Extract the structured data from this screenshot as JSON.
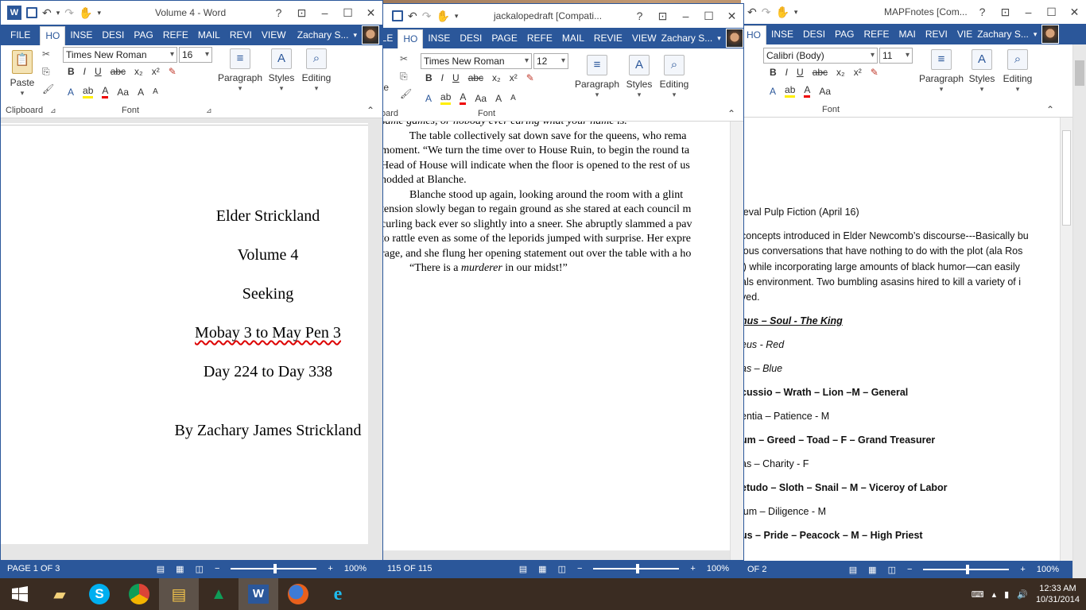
{
  "windows": {
    "left": {
      "title": "Volume 4 - Word",
      "tabs": [
        "FILE",
        "HO",
        "INSE",
        "DESI",
        "PAG",
        "REFE",
        "MAIL",
        "REVI",
        "VIEW"
      ],
      "user": "Zachary S...",
      "font_name": "Times New Roman",
      "font_size": "16",
      "groups": {
        "clipboard": "Clipboard",
        "font": "Font"
      },
      "paste_label": "Paste",
      "paragraph_label": "Paragraph",
      "styles_label": "Styles",
      "editing_label": "Editing",
      "doc_lines": [
        "Elder Strickland",
        "Volume 4",
        "Seeking",
        "Mobay 3 to May Pen 3",
        "Day 224 to Day 338",
        "By Zachary James Strickland"
      ],
      "status_page": "PAGE 1 OF 3",
      "zoom": "100%"
    },
    "middle": {
      "title": "jackalopedraft [Compati...",
      "tabs": [
        "FILE",
        "HO",
        "INSE",
        "DESI",
        "PAGE",
        "REFE",
        "MAIL",
        "REVIE",
        "VIEW"
      ],
      "user": "Zachary S...",
      "font_name": "Times New Roman",
      "font_size": "12",
      "groups": {
        "clipboard": "oard",
        "font": "Font"
      },
      "paste_label": "te",
      "paragraph_label": "Paragraph",
      "styles_label": "Styles",
      "editing_label": "Editing",
      "paragraphs": [
        "same games, or nobody ever caring what your name is.",
        "        The table collectively sat down save for the queens, who rema",
        "moment. “We turn the time over to House Ruin, to begin the round ta",
        "Head of House will indicate when the floor is opened to the rest of us",
        "nodded at Blanche.",
        "        Blanche stood up again, looking around the room with a glint",
        "tension slowly began to regain ground as she stared at each council m",
        "curling back ever so slightly into a sneer. She abruptly slammed a pav",
        "to rattle even as some of the leporids jumped with surprise. Her expre",
        "rage, and she flung her opening statement out over the table with a ho",
        "        “There is a murderer in our midst!”"
      ],
      "status_page": "115 OF 115",
      "zoom": "100%"
    },
    "right": {
      "title": "MAPFnotes [Com...",
      "tabs": [
        "HO",
        "INSE",
        "DESI",
        "PAG",
        "REFE",
        "MAI",
        "REVI",
        "VIE"
      ],
      "user": "Zachary S...",
      "font_name": "Calibri (Body)",
      "font_size": "11",
      "groups": {
        "font": "Font"
      },
      "paragraph_label": "Paragraph",
      "styles_label": "Styles",
      "editing_label": "Editing",
      "lines": [
        "ieval Pulp Fiction (April 16)",
        "concepts introduced in Elder Newcomb’s discourse---Basically bu",
        "ious conversations that have nothing to do with the plot (ala Ros",
        "l) while incorporating large amounts of black humor—can easily",
        "als environment. Two bumbling asasins hired to kill a variety of i",
        "ved.",
        "nus – Soul - The King",
        "eus - Red",
        "as – Blue",
        "cussio – Wrath – Lion –M – General",
        "entia – Patience - M",
        "um – Greed – Toad – F – Grand Treasurer",
        "as – Charity - F",
        "etudo – Sloth – Snail – M – Viceroy of Labor",
        "ium – Diligence - M",
        "us – Pride – Peacock – M – High Priest"
      ],
      "status_page": "OF 2",
      "zoom": "100%"
    }
  },
  "taskbar": {
    "apps": [
      "start",
      "file-explorer-folder",
      "skype",
      "chrome",
      "file-explorer",
      "google-drive",
      "word",
      "firefox",
      "internet-explorer"
    ],
    "time": "12:33 AM",
    "date": "10/31/2014"
  }
}
